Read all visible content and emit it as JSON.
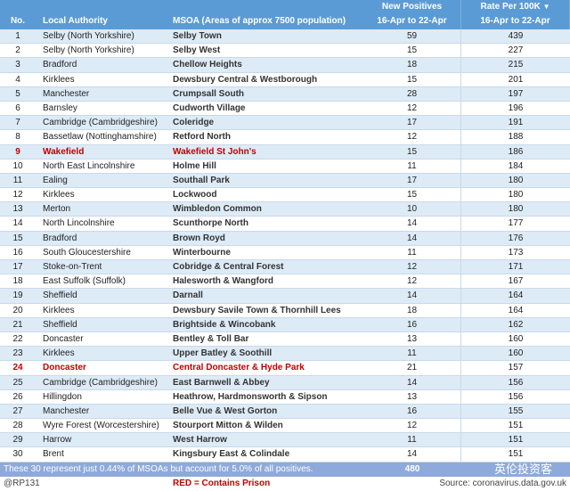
{
  "header": {
    "no": "No.",
    "la": "Local Authority",
    "msoa": "MSOA (Areas of approx 7500 population)",
    "np1": "New Positives",
    "np2": "16-Apr to 22-Apr",
    "rate1": "Rate Per 100K",
    "rate2": "16-Apr to 22-Apr",
    "sort_icon": "sort-descending-icon"
  },
  "rows": [
    {
      "no": "1",
      "la": "Selby (North Yorkshire)",
      "msoa": "Selby Town",
      "np": "59",
      "rate": "439",
      "prison": false
    },
    {
      "no": "2",
      "la": "Selby (North Yorkshire)",
      "msoa": "Selby West",
      "np": "15",
      "rate": "227",
      "prison": false
    },
    {
      "no": "3",
      "la": "Bradford",
      "msoa": "Chellow Heights",
      "np": "18",
      "rate": "215",
      "prison": false
    },
    {
      "no": "4",
      "la": "Kirklees",
      "msoa": "Dewsbury Central & Westborough",
      "np": "15",
      "rate": "201",
      "prison": false
    },
    {
      "no": "5",
      "la": "Manchester",
      "msoa": "Crumpsall South",
      "np": "28",
      "rate": "197",
      "prison": false
    },
    {
      "no": "6",
      "la": "Barnsley",
      "msoa": "Cudworth Village",
      "np": "12",
      "rate": "196",
      "prison": false
    },
    {
      "no": "7",
      "la": "Cambridge (Cambridgeshire)",
      "msoa": "Coleridge",
      "np": "17",
      "rate": "191",
      "prison": false
    },
    {
      "no": "8",
      "la": "Bassetlaw (Nottinghamshire)",
      "msoa": "Retford North",
      "np": "12",
      "rate": "188",
      "prison": false
    },
    {
      "no": "9",
      "la": "Wakefield",
      "msoa": "Wakefield St John's",
      "np": "15",
      "rate": "186",
      "prison": true
    },
    {
      "no": "10",
      "la": "North East Lincolnshire",
      "msoa": "Holme Hill",
      "np": "11",
      "rate": "184",
      "prison": false
    },
    {
      "no": "11",
      "la": "Ealing",
      "msoa": "Southall Park",
      "np": "17",
      "rate": "180",
      "prison": false
    },
    {
      "no": "12",
      "la": "Kirklees",
      "msoa": "Lockwood",
      "np": "15",
      "rate": "180",
      "prison": false
    },
    {
      "no": "13",
      "la": "Merton",
      "msoa": "Wimbledon Common",
      "np": "10",
      "rate": "180",
      "prison": false
    },
    {
      "no": "14",
      "la": "North Lincolnshire",
      "msoa": "Scunthorpe North",
      "np": "14",
      "rate": "177",
      "prison": false
    },
    {
      "no": "15",
      "la": "Bradford",
      "msoa": "Brown Royd",
      "np": "14",
      "rate": "176",
      "prison": false
    },
    {
      "no": "16",
      "la": "South Gloucestershire",
      "msoa": "Winterbourne",
      "np": "11",
      "rate": "173",
      "prison": false
    },
    {
      "no": "17",
      "la": "Stoke-on-Trent",
      "msoa": "Cobridge & Central Forest",
      "np": "12",
      "rate": "171",
      "prison": false
    },
    {
      "no": "18",
      "la": "East Suffolk (Suffolk)",
      "msoa": "Halesworth & Wangford",
      "np": "12",
      "rate": "167",
      "prison": false
    },
    {
      "no": "19",
      "la": "Sheffield",
      "msoa": "Darnall",
      "np": "14",
      "rate": "164",
      "prison": false
    },
    {
      "no": "20",
      "la": "Kirklees",
      "msoa": "Dewsbury Savile Town & Thornhill Lees",
      "np": "18",
      "rate": "164",
      "prison": false
    },
    {
      "no": "21",
      "la": "Sheffield",
      "msoa": "Brightside & Wincobank",
      "np": "16",
      "rate": "162",
      "prison": false
    },
    {
      "no": "22",
      "la": "Doncaster",
      "msoa": "Bentley & Toll Bar",
      "np": "13",
      "rate": "160",
      "prison": false
    },
    {
      "no": "23",
      "la": "Kirklees",
      "msoa": "Upper Batley & Soothill",
      "np": "11",
      "rate": "160",
      "prison": false
    },
    {
      "no": "24",
      "la": "Doncaster",
      "msoa": "Central Doncaster & Hyde Park",
      "np": "21",
      "rate": "157",
      "prison": true
    },
    {
      "no": "25",
      "la": "Cambridge (Cambridgeshire)",
      "msoa": "East Barnwell & Abbey",
      "np": "14",
      "rate": "156",
      "prison": false
    },
    {
      "no": "26",
      "la": "Hillingdon",
      "msoa": "Heathrow, Hardmonsworth & Sipson",
      "np": "13",
      "rate": "156",
      "prison": false
    },
    {
      "no": "27",
      "la": "Manchester",
      "msoa": "Belle Vue & West Gorton",
      "np": "16",
      "rate": "155",
      "prison": false
    },
    {
      "no": "28",
      "la": "Wyre Forest (Worcestershire)",
      "msoa": "Stourport Mitton & Wilden",
      "np": "12",
      "rate": "151",
      "prison": false
    },
    {
      "no": "29",
      "la": "Harrow",
      "msoa": "West Harrow",
      "np": "11",
      "rate": "151",
      "prison": false
    },
    {
      "no": "30",
      "la": "Brent",
      "msoa": "Kingsbury East & Colindale",
      "np": "14",
      "rate": "151",
      "prison": false
    }
  ],
  "total": {
    "text": "These 30 represent just 0.44% of MSOAs but account for 5.0% of all positives.",
    "np": "480"
  },
  "footer": {
    "handle": "@RP131",
    "legend": "RED = Contains Prison",
    "source": "Source: coronavirus.data.gov.uk"
  },
  "watermark": "英伦投资客",
  "colors": {
    "header": "#5b9bd5",
    "alt_row": "#ddebf7",
    "total": "#8eaadb",
    "prison": "#c00000"
  }
}
